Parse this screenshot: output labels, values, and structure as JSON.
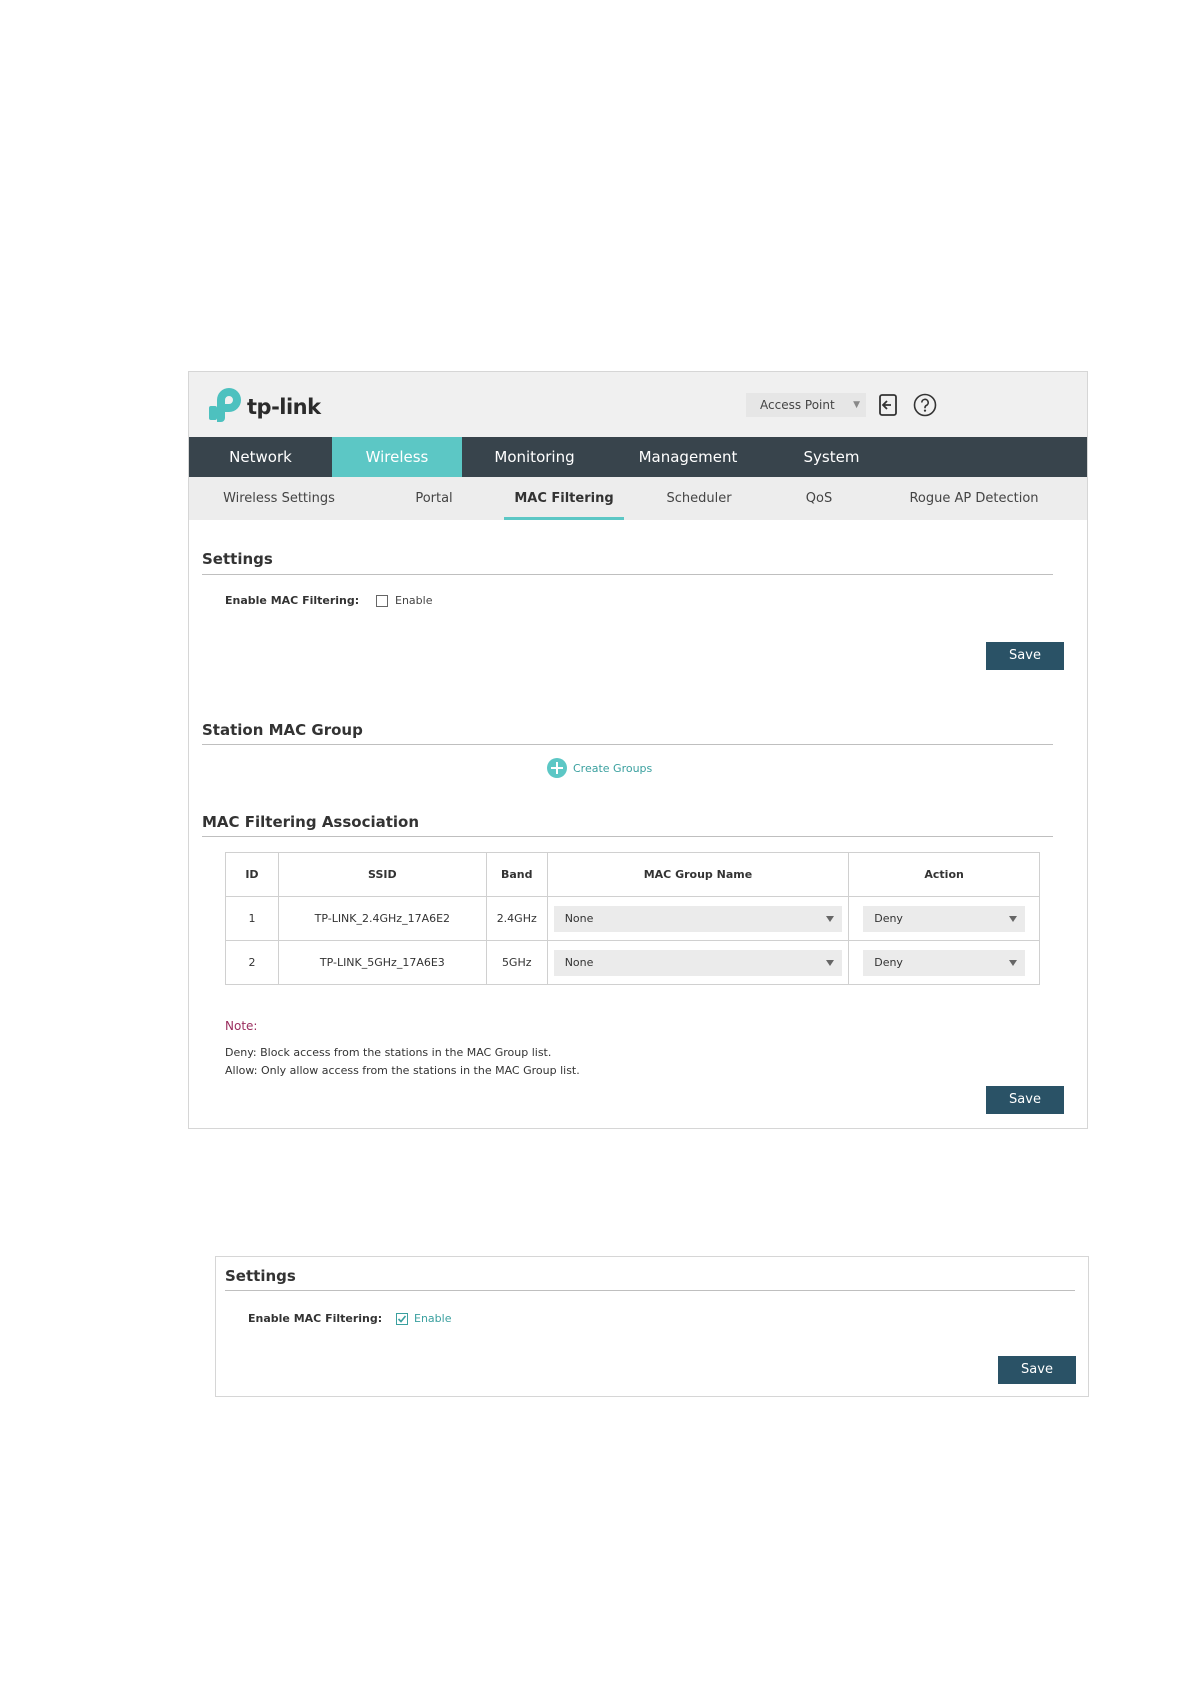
{
  "header": {
    "logo_text": "tp-link",
    "mode_select": "Access Point",
    "colors": {
      "accent": "#5cc7c5",
      "nav_bg": "#38444c",
      "button": "#2a5266",
      "note": "#9b2d5e"
    }
  },
  "main_nav": [
    {
      "label": "Network"
    },
    {
      "label": "Wireless",
      "active": true
    },
    {
      "label": "Monitoring"
    },
    {
      "label": "Management"
    },
    {
      "label": "System"
    }
  ],
  "sub_nav": [
    {
      "label": "Wireless Settings"
    },
    {
      "label": "Portal"
    },
    {
      "label": "MAC Filtering",
      "active": true
    },
    {
      "label": "Scheduler"
    },
    {
      "label": "QoS"
    },
    {
      "label": "Rogue AP Detection"
    }
  ],
  "settings": {
    "title": "Settings",
    "field_label": "Enable MAC Filtering:",
    "checkbox_label": "Enable",
    "save_label": "Save"
  },
  "station_mac_group": {
    "title": "Station MAC Group",
    "create_label": "Create Groups"
  },
  "association": {
    "title": "MAC Filtering Association",
    "columns": [
      "ID",
      "SSID",
      "Band",
      "MAC Group Name",
      "Action"
    ],
    "rows": [
      {
        "id": "1",
        "ssid": "TP-LINK_2.4GHz_17A6E2",
        "band": "2.4GHz",
        "group": "None",
        "action": "Deny"
      },
      {
        "id": "2",
        "ssid": "TP-LINK_5GHz_17A6E3",
        "band": "5GHz",
        "group": "None",
        "action": "Deny"
      }
    ],
    "note_title": "Note:",
    "note_deny": "Deny: Block access from the stations in the MAC Group list.",
    "note_allow": "Allow: Only allow access from the stations in the MAC Group list.",
    "save_label": "Save"
  },
  "settings2": {
    "title": "Settings",
    "field_label": "Enable MAC Filtering:",
    "checkbox_label": "Enable",
    "checked": true,
    "save_label": "Save"
  }
}
